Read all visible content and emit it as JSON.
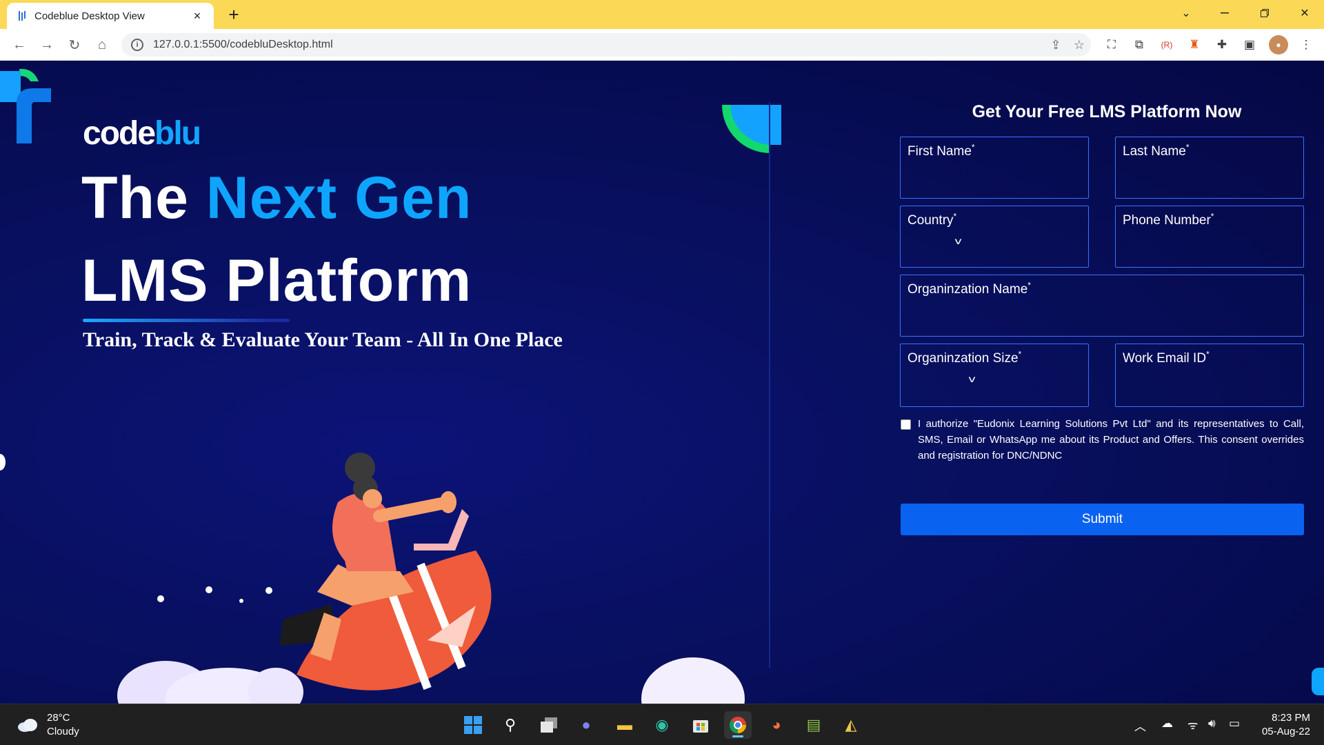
{
  "browser": {
    "tab_title": "Codeblue Desktop View",
    "close_tab": "×",
    "new_tab": "+",
    "url": "127.0.0.1:5500/codebluDesktop.html"
  },
  "page": {
    "logo": {
      "part1": "code",
      "part2": "blu"
    },
    "headline_1_plain": "The ",
    "headline_1_highlight": "Next Gen",
    "headline_2": "LMS Platform",
    "tagline": "Train, Track & Evaluate Your Team - All In One Place",
    "colors": {
      "accent": "#0ea5ff",
      "background": "#0a0c4a",
      "button": "#0a62f0",
      "field_border": "#3a72ff"
    }
  },
  "form": {
    "title": "Get Your Free LMS Platform Now",
    "required_mark": "*",
    "first_name": "First Name",
    "last_name": "Last Name",
    "country": "Country",
    "phone": "Phone Number",
    "org_name": "Organinzation Name",
    "org_size": "Organinzation Size",
    "work_email": "Work Email ID",
    "consent": "I authorize \"Eudonix Learning Solutions Pvt Ltd\" and its representatives to Call, SMS, Email or WhatsApp me about its Product and Offers. This consent overrides and registration for DNC/NDNC",
    "submit": "Submit"
  },
  "taskbar": {
    "temperature": "28°C",
    "condition": "Cloudy",
    "time": "8:23 PM",
    "date": "05-Aug-22"
  }
}
